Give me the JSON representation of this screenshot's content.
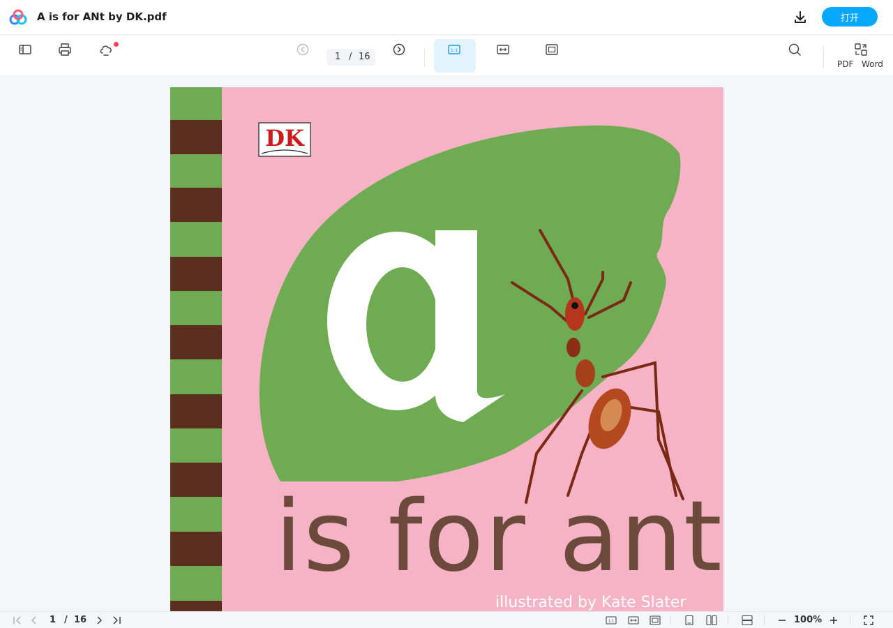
{
  "header": {
    "title": "A is for ANt by DK.pdf",
    "primary_button_label": "打开"
  },
  "toolbar": {
    "current_page": "1",
    "page_separator": "/",
    "total_pages": "16",
    "convert_pdf_label": "PDF",
    "convert_word_label": "Word"
  },
  "document": {
    "publisher_logo_text": "DK",
    "headline_letter": "a",
    "headline_text": "is for ant",
    "credit_text": "illustrated by Kate Slater"
  },
  "statusbar": {
    "current_page": "1",
    "page_separator": "/",
    "total_pages": "16",
    "zoom_level": "100%"
  },
  "colors": {
    "accent": "#06a7ff",
    "page_background": "#f6b3c6",
    "leaf_green": "#6fab52",
    "stripe_brown": "#5c2e20",
    "headline_brown": "#6b4a3c"
  }
}
